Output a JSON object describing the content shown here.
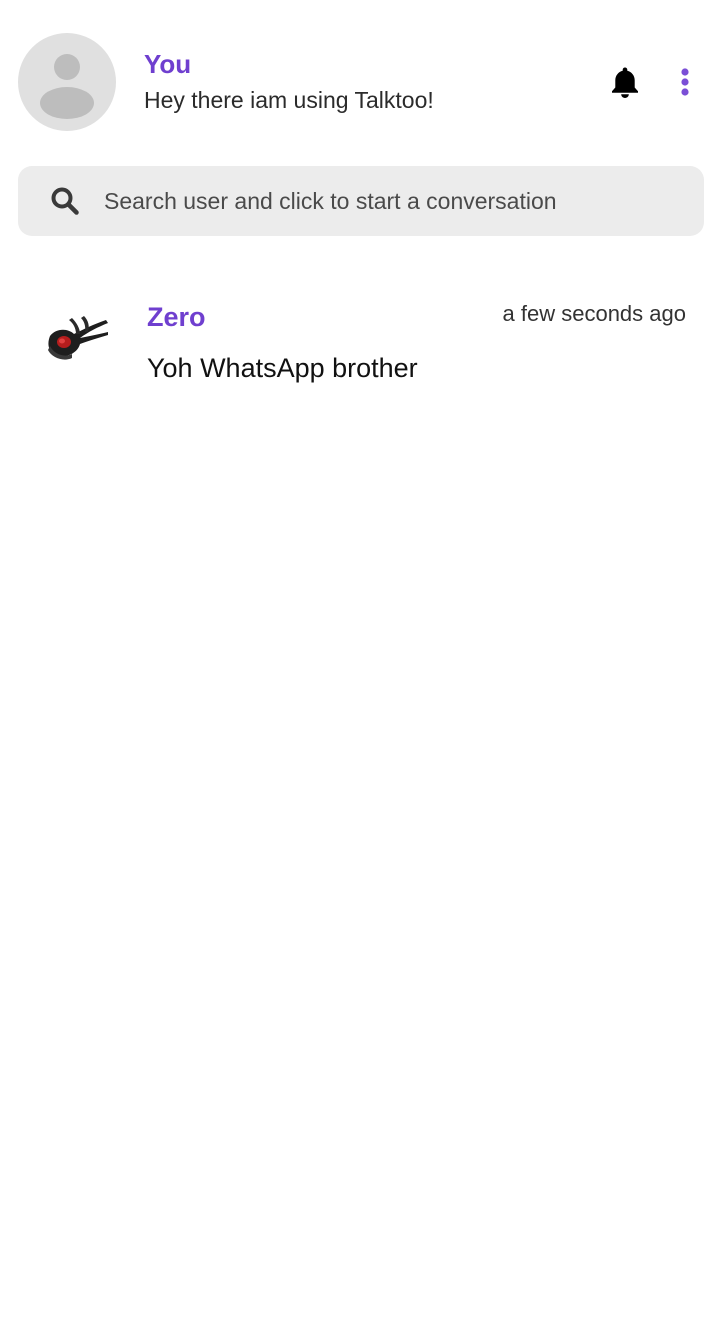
{
  "colors": {
    "accent": "#6f3fcf",
    "search_background": "#ececec",
    "avatar_placeholder": "#e0e0e0"
  },
  "profile": {
    "name": "You",
    "status": "Hey there iam using Talktoo!",
    "avatar_icon": "default-user-avatar-icon"
  },
  "header": {
    "notification_icon": "bell-icon",
    "menu_icon": "more-vertical-icon"
  },
  "search": {
    "icon": "search-icon",
    "placeholder": "Search user and click to start a conversation",
    "value": ""
  },
  "conversations": [
    {
      "name": "Zero",
      "message": "Yoh WhatsApp brother",
      "time": "a few seconds ago",
      "avatar_icon": "contact-photo-avatar"
    }
  ]
}
